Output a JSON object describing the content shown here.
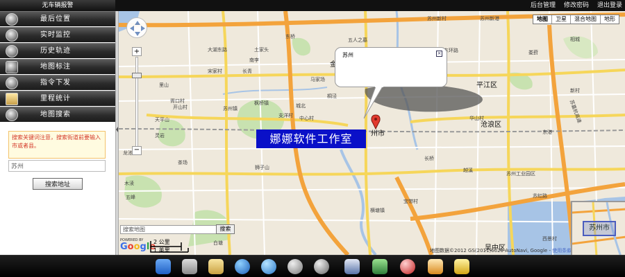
{
  "header": {
    "left_title": "无车辆报警",
    "links": [
      "后台管理",
      "修改密码",
      "退出登录"
    ]
  },
  "sidebar": {
    "menu": [
      {
        "label": "最后位置",
        "icon": "location-icon"
      },
      {
        "label": "实时监控",
        "icon": "monitor-icon"
      },
      {
        "label": "历史轨迹",
        "icon": "history-track-icon"
      },
      {
        "label": "地图标注",
        "icon": "map-marker-icon"
      },
      {
        "label": "指令下发",
        "icon": "command-icon"
      },
      {
        "label": "里程统计",
        "icon": "mileage-icon"
      },
      {
        "label": "地图搜索",
        "icon": "map-search-icon"
      }
    ],
    "search": {
      "hint": "搜索关键词注意，搜索街道前要输入市或者县。",
      "value": "苏州",
      "button": "搜索地址"
    }
  },
  "map": {
    "type_buttons": [
      "地图",
      "卫星",
      "混合地图",
      "地形"
    ],
    "info_window_title": "苏州",
    "watermark": "娜娜软件工作室",
    "search_placeholder": "搜索地图",
    "search_button": "搜索",
    "powered_by": "POWERED BY",
    "google": "Google",
    "scale_km": "2 公里",
    "scale_mi": "1 英里",
    "copyright": "地图数据©2012 GS(2011)6020 AutoNavi, Google - ",
    "terms": "使用条款",
    "overview_label": "苏州市",
    "districts": [
      "平江区",
      "沧浪区",
      "吴中区",
      "州市"
    ],
    "labels": [
      "大湖东路",
      "土家头",
      "东桥",
      "南李",
      "五人之墓",
      "苏州新村",
      "苏州新港",
      "金",
      "里山",
      "宋家村",
      "长青",
      "马家场",
      "桐泾",
      "胥口村",
      "开山村",
      "苏州镇",
      "枫桥镇",
      "支洋村",
      "城北",
      "中心村",
      "天平山",
      "灵岩",
      "茶场",
      "狮子山",
      "龙池",
      "木渎",
      "五峰",
      "白塘",
      "长桥",
      "越溪",
      "横塘镇",
      "宝带村",
      "苏州工业园区",
      "华山村",
      "东港",
      "娄葑",
      "新村",
      "相城",
      "西景村",
      "东环路",
      "苏嘉杭高速",
      "苏虹路"
    ]
  },
  "dock": {
    "icons": [
      "finder-icon",
      "mail-icon",
      "photo-icon",
      "globe-icon",
      "browser-icon",
      "search-icon",
      "zoom-icon",
      "tools-icon",
      "settings-icon",
      "safari-icon",
      "apps-icon",
      "clean-icon"
    ]
  },
  "colors": {
    "watermark_bg": "#0a10c8",
    "hint_text": "#d43a2a",
    "road_yellow": "#f6d65a",
    "road_orange": "#f3a33c",
    "water": "#a7c4e6",
    "green": "#c8e2b0"
  }
}
